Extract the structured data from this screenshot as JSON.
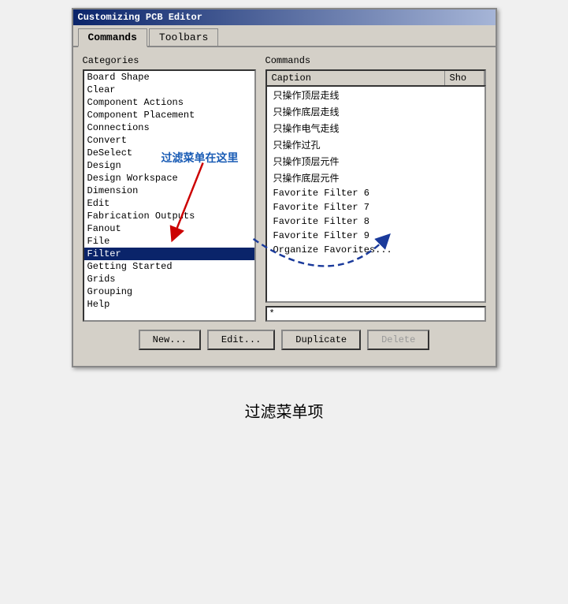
{
  "window": {
    "title": "Customizing PCB Editor"
  },
  "tabs": [
    {
      "label": "Commands",
      "active": true
    },
    {
      "label": "Toolbars",
      "active": false
    }
  ],
  "categories_label": "Categories",
  "commands_label": "Commands",
  "caption_label": "Caption",
  "shortcut_label": "Sho",
  "categories": [
    {
      "text": "Board Shape"
    },
    {
      "text": "Clear"
    },
    {
      "text": "Component Actions"
    },
    {
      "text": "Component Placement"
    },
    {
      "text": "Connections"
    },
    {
      "text": "Convert"
    },
    {
      "text": "DeSelect"
    },
    {
      "text": "Design"
    },
    {
      "text": "Design Workspace"
    },
    {
      "text": "Dimension"
    },
    {
      "text": "Edit"
    },
    {
      "text": "Fabrication Outputs"
    },
    {
      "text": "Fanout"
    },
    {
      "text": "File"
    },
    {
      "text": "Filter",
      "selected": true
    },
    {
      "text": "Getting Started"
    },
    {
      "text": "Grids"
    },
    {
      "text": "Grouping"
    },
    {
      "text": "Help"
    }
  ],
  "commands": [
    {
      "text": "只操作顶层走线"
    },
    {
      "text": "只操作底层走线"
    },
    {
      "text": "只操作电气走线"
    },
    {
      "text": "只操作过孔"
    },
    {
      "text": "只操作顶层元件"
    },
    {
      "text": "只操作底层元件"
    },
    {
      "text": "Favorite Filter 6"
    },
    {
      "text": "Favorite Filter 7"
    },
    {
      "text": "Favorite Filter 8"
    },
    {
      "text": "Favorite Filter 9"
    },
    {
      "text": "Organize Favorites..."
    }
  ],
  "filter_value": "*",
  "buttons": {
    "new_label": "New...",
    "edit_label": "Edit...",
    "duplicate_label": "Duplicate",
    "delete_label": "Delete"
  },
  "annotation": {
    "text": "过滤菜单在这里",
    "bottom_label": "过滤菜单项"
  }
}
